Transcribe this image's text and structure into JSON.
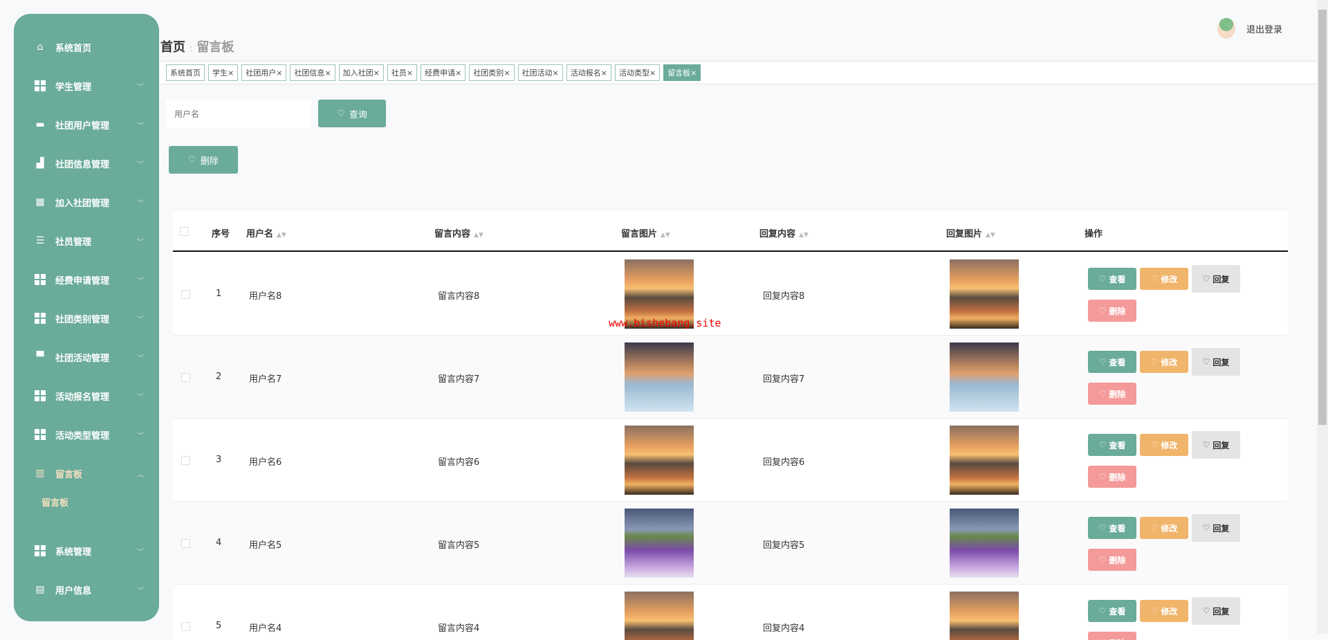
{
  "sidebar": {
    "items": [
      {
        "label": "系统首页",
        "icon": "home-icon"
      },
      {
        "label": "学生管理",
        "icon": "grid-icon"
      },
      {
        "label": "社团用户管理",
        "icon": "ticket-icon"
      },
      {
        "label": "社团信息管理",
        "icon": "building-icon"
      },
      {
        "label": "加入社团管理",
        "icon": "table-icon"
      },
      {
        "label": "社员管理",
        "icon": "list-icon"
      },
      {
        "label": "经费申请管理",
        "icon": "grid-icon"
      },
      {
        "label": "社团类别管理",
        "icon": "grid-icon"
      },
      {
        "label": "社团活动管理",
        "icon": "monitor-icon"
      },
      {
        "label": "活动报名管理",
        "icon": "grid-icon"
      },
      {
        "label": "活动类型管理",
        "icon": "grid-icon"
      },
      {
        "label": "留言板",
        "icon": "chart-icon"
      },
      {
        "label": "系统管理",
        "icon": "grid-icon"
      },
      {
        "label": "用户信息",
        "icon": "card-icon"
      }
    ],
    "sub_item": "留言板"
  },
  "breadcrumb": {
    "home": "首页",
    "sep": ":",
    "current": "留言板"
  },
  "header": {
    "logout": "退出登录"
  },
  "tags": [
    "系统首页",
    "学生",
    "社团用户",
    "社团信息",
    "加入社团",
    "社员",
    "经费申请",
    "社团类别",
    "社团活动",
    "活动报名",
    "活动类型",
    "留言板"
  ],
  "search": {
    "placeholder": "用户名",
    "query_label": "查询",
    "delete_label": "删除"
  },
  "table": {
    "headers": [
      "序号",
      "用户名",
      "留言内容",
      "留言图片",
      "回复内容",
      "回复图片",
      "操作"
    ],
    "rows": [
      {
        "index": "1",
        "username": "用户名8",
        "content": "留言内容8",
        "reply": "回复内容8",
        "img": "sunset"
      },
      {
        "index": "2",
        "username": "用户名7",
        "content": "留言内容7",
        "reply": "回复内容7",
        "img": "lake"
      },
      {
        "index": "3",
        "username": "用户名6",
        "content": "留言内容6",
        "reply": "回复内容6",
        "img": "sunset"
      },
      {
        "index": "4",
        "username": "用户名5",
        "content": "留言内容5",
        "reply": "回复内容5",
        "img": "lav"
      },
      {
        "index": "5",
        "username": "用户名4",
        "content": "留言内容4",
        "reply": "回复内容4",
        "img": "sunset"
      }
    ],
    "actions": {
      "view": "查看",
      "edit": "修改",
      "reply": "回复",
      "delete": "删除"
    }
  },
  "watermark": "www.bishebang.site",
  "colors": {
    "primary": "#6aab9a",
    "edit": "#f0b46a",
    "delete": "#f49a9a",
    "active": "#f3dfc0"
  }
}
